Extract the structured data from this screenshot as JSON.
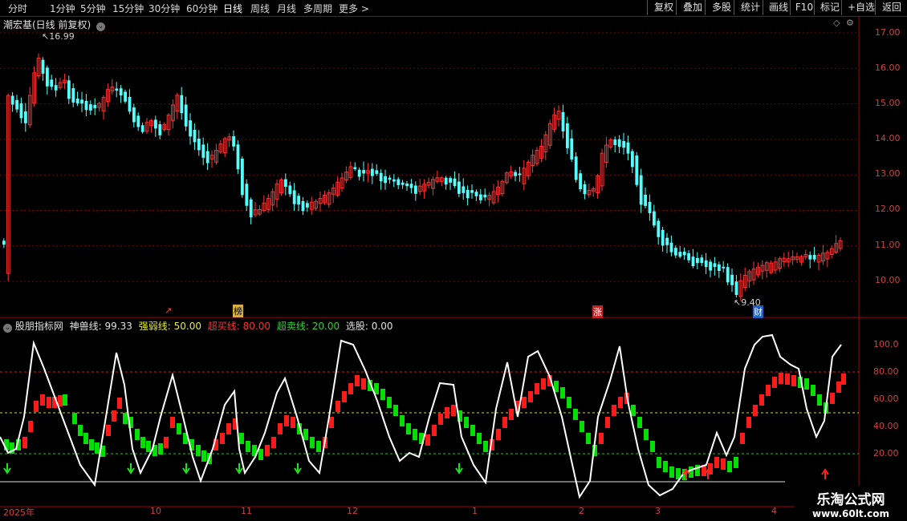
{
  "toolbar": {
    "periods": [
      "分时",
      "1分钟",
      "5分钟",
      "15分钟",
      "30分钟",
      "60分钟",
      "日线",
      "周线",
      "月线",
      "多周期",
      "更多 >"
    ],
    "active_period": "日线",
    "right_buttons": [
      "复权",
      "叠加",
      "多股",
      "统计",
      "画线",
      "F10",
      "+自选",
      "返回"
    ]
  },
  "main_chart": {
    "title": "潮宏基(日线 前复权)",
    "high_label": "16.99",
    "low_label": "9.40",
    "y_ticks": [
      "17.00",
      "16.00",
      "15.00",
      "14.00",
      "13.00",
      "12.00",
      "11.00",
      "10.00"
    ],
    "event_markers": [
      {
        "text": "↗"
      },
      {
        "text": "榜"
      },
      {
        "text": "涨"
      },
      {
        "text": "财"
      }
    ]
  },
  "indicator": {
    "name": "股朋指标网",
    "lines": [
      {
        "label": "神兽线:",
        "value": "99.33",
        "color": "#e0e0e0"
      },
      {
        "label": "强弱线:",
        "value": "50.00",
        "color": "#e8e840"
      },
      {
        "label": "超买线:",
        "value": "80.00",
        "color": "#ff3030"
      },
      {
        "label": "超卖线:",
        "value": "20.00",
        "color": "#30d030"
      },
      {
        "label": "选股:",
        "value": "0.00",
        "color": "#e0e0e0"
      }
    ],
    "y_ticks": [
      "100.0",
      "80.00",
      "60.00",
      "40.00",
      "20.00"
    ]
  },
  "date_axis": [
    "2025年",
    "10",
    "11",
    "12",
    "1",
    "2",
    "3",
    "4"
  ],
  "watermark": {
    "line1": "乐淘公式网",
    "line2": "www.60lt.com"
  },
  "colors": {
    "up": "#ff3232",
    "down": "#54ffff",
    "bar_up": "#ff1a1a",
    "bar_down": "#00e000",
    "grid": "#7a0000"
  }
}
